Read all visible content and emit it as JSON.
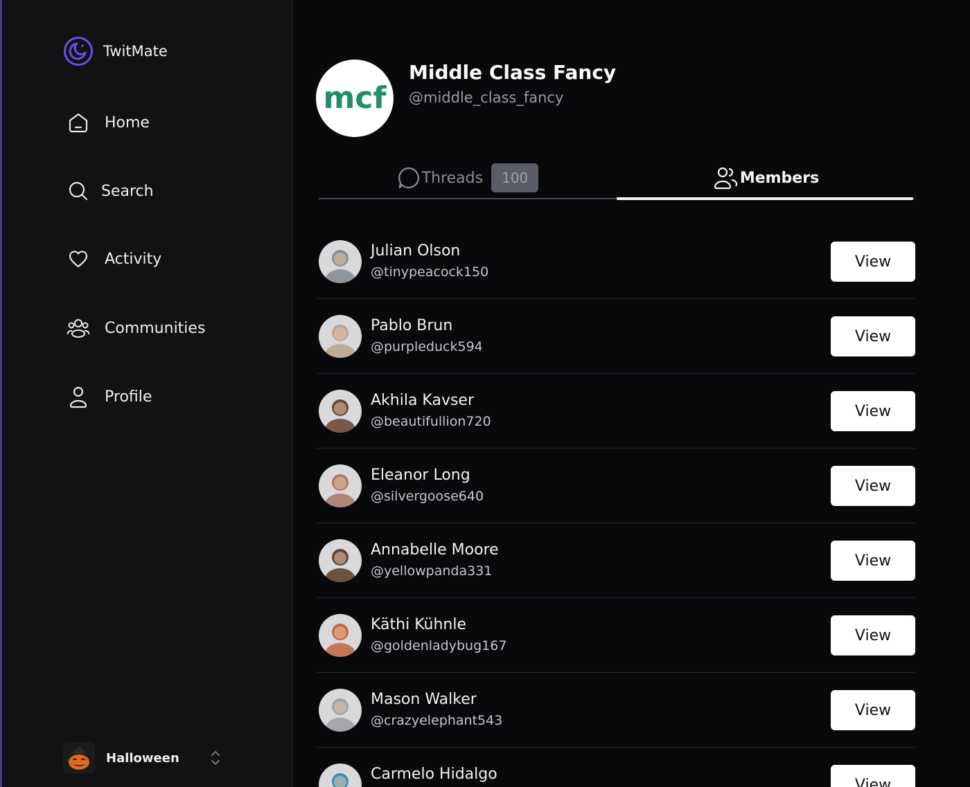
{
  "app": {
    "name": "TwitMate",
    "accent": "#6c4fe8"
  },
  "sidebar": {
    "items": [
      {
        "label": "Home",
        "icon": "home-icon"
      },
      {
        "label": "Search",
        "icon": "search-icon"
      },
      {
        "label": "Activity",
        "icon": "heart-icon"
      },
      {
        "label": "Communities",
        "icon": "communities-icon"
      },
      {
        "label": "Profile",
        "icon": "user-icon"
      }
    ],
    "team": {
      "label": "Halloween",
      "icon": "pumpkin-icon"
    }
  },
  "community": {
    "logo_text": "mcf",
    "logo_color": "#1f8f64",
    "name": "Middle Class Fancy",
    "handle": "@middle_class_fancy"
  },
  "tabs": [
    {
      "label": "Threads",
      "icon": "chat-bubble-icon",
      "count": "100",
      "active": false
    },
    {
      "label": "Members",
      "icon": "members-icon",
      "active": true
    }
  ],
  "members": [
    {
      "name": "Julian Olson",
      "handle": "@tinypeacock150",
      "button": "View",
      "avatar_color": "#8a8f96"
    },
    {
      "name": "Pablo Brun",
      "handle": "@purpleduck594",
      "button": "View",
      "avatar_color": "#b9a592"
    },
    {
      "name": "Akhila Kavser",
      "handle": "@beautifullion720",
      "button": "View",
      "avatar_color": "#6b4a3a"
    },
    {
      "name": "Eleanor Long",
      "handle": "@silvergoose640",
      "button": "View",
      "avatar_color": "#a97b6a"
    },
    {
      "name": "Annabelle Moore",
      "handle": "@yellowpanda331",
      "button": "View",
      "avatar_color": "#5e4433"
    },
    {
      "name": "Käthi Kühnle",
      "handle": "@goldenladybug167",
      "button": "View",
      "avatar_color": "#c06a45"
    },
    {
      "name": "Mason Walker",
      "handle": "@crazyelephant543",
      "button": "View",
      "avatar_color": "#9da2a6"
    },
    {
      "name": "Carmelo Hidalgo",
      "handle": "",
      "button": "View",
      "avatar_color": "#3e8fb5"
    }
  ]
}
